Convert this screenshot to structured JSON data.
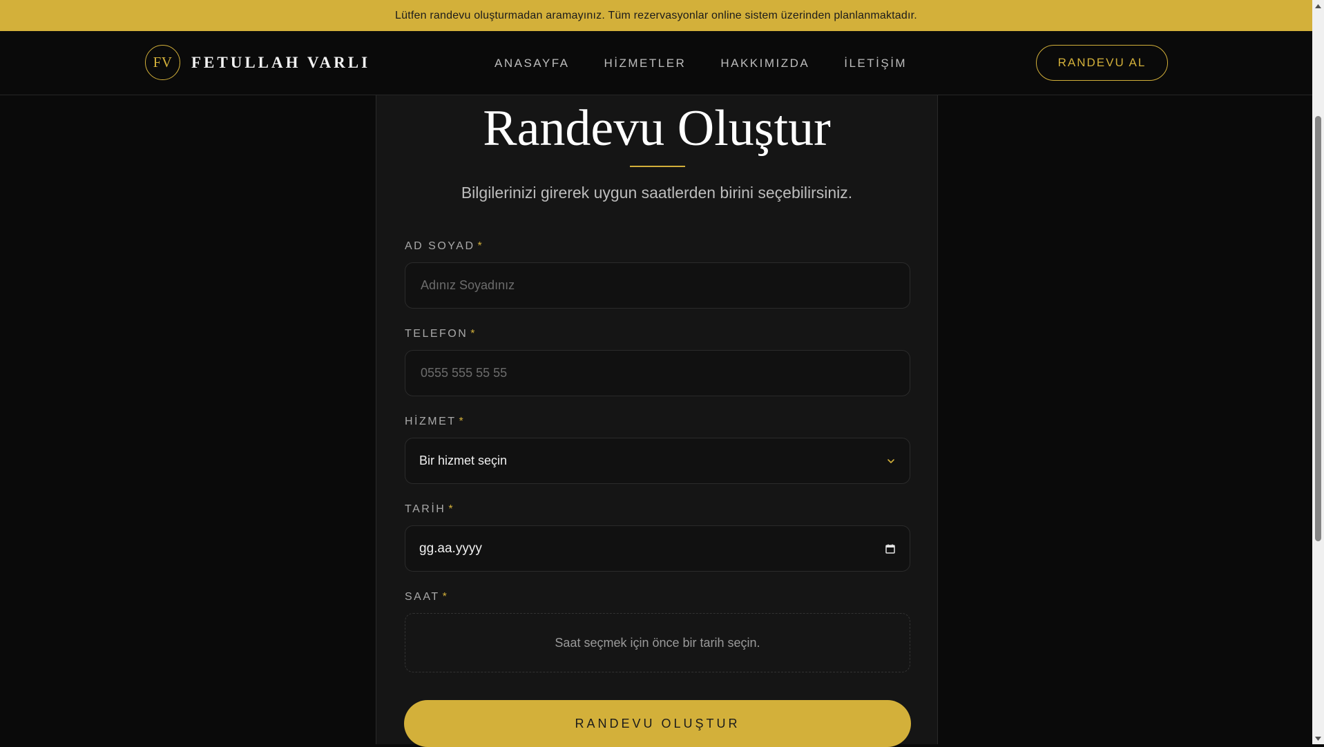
{
  "announcement": {
    "text": "Lütfen randevu oluşturmadan aramayınız. Tüm rezervasyonlar online sistem üzerinden planlanmaktadır."
  },
  "header": {
    "logo_mark": "FV",
    "logo_text": "FETULLAH VARLI",
    "nav": [
      {
        "label": "ANASAYFA"
      },
      {
        "label": "HİZMETLER"
      },
      {
        "label": "HAKKIMIZDA"
      },
      {
        "label": "İLETİŞİM"
      }
    ],
    "cta_label": "RANDEVU AL"
  },
  "form": {
    "title": "Randevu Oluştur",
    "subtitle": "Bilgilerinizi girerek uygun saatlerden birini seçebilirsiniz.",
    "required_mark": "*",
    "name": {
      "label": "AD SOYAD",
      "value": "",
      "placeholder": "Adınız Soyadınız"
    },
    "phone": {
      "label": "TELEFON",
      "value": "",
      "placeholder": "0555 555 55 55"
    },
    "service": {
      "label": "HİZMET",
      "selected": "Bir hizmet seçin"
    },
    "date": {
      "label": "TARİH",
      "value": "gg.aa.yyyy"
    },
    "time": {
      "label": "SAAT",
      "empty_message": "Saat seçmek için önce bir tarih seçin."
    },
    "submit_label": "RANDEVU OLUŞTUR"
  },
  "icons": {
    "service_dropdown": "chevron-down-icon",
    "date_picker": "calendar-icon",
    "scroll_up": "arrow-up-icon",
    "scroll_down": "arrow-down-icon"
  },
  "colors": {
    "accent": "#d3b03a",
    "background": "#0a0a0a",
    "card": "#151515"
  }
}
